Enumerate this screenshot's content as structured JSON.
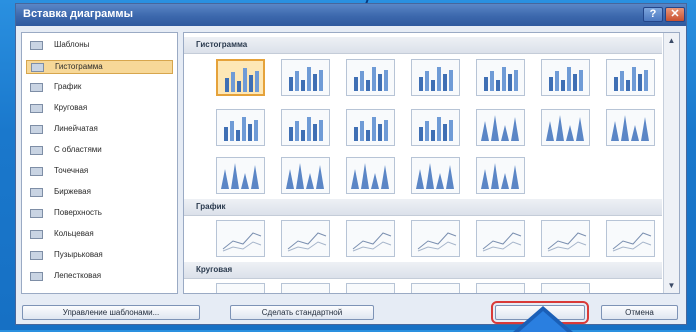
{
  "window": {
    "title": "Вставка диаграммы"
  },
  "titlebar_buttons": {
    "help": "?",
    "close": "✕"
  },
  "sidebar": {
    "items": [
      {
        "label": "Шаблоны",
        "icon": "folder-icon",
        "selected": false
      },
      {
        "label": "Гистограмма",
        "icon": "column-chart-icon",
        "selected": true
      },
      {
        "label": "График",
        "icon": "line-chart-icon",
        "selected": false
      },
      {
        "label": "Круговая",
        "icon": "pie-chart-icon",
        "selected": false
      },
      {
        "label": "Линейчатая",
        "icon": "bar-chart-icon",
        "selected": false
      },
      {
        "label": "С областями",
        "icon": "area-chart-icon",
        "selected": false
      },
      {
        "label": "Точечная",
        "icon": "scatter-chart-icon",
        "selected": false
      },
      {
        "label": "Биржевая",
        "icon": "stock-chart-icon",
        "selected": false
      },
      {
        "label": "Поверхность",
        "icon": "surface-chart-icon",
        "selected": false
      },
      {
        "label": "Кольцевая",
        "icon": "doughnut-chart-icon",
        "selected": false
      },
      {
        "label": "Пузырьковая",
        "icon": "bubble-chart-icon",
        "selected": false
      },
      {
        "label": "Лепестковая",
        "icon": "radar-chart-icon",
        "selected": false
      }
    ]
  },
  "gallery": {
    "sections": [
      {
        "title": "Гистограмма"
      },
      {
        "title": "График"
      },
      {
        "title": "Круговая"
      }
    ]
  },
  "buttons": {
    "manage_templates": "Управление шаблонами...",
    "set_default": "Сделать стандартной",
    "ok": "",
    "cancel": "Отмена"
  },
  "colors": {
    "background": "#1c7fd2",
    "titlebar": "#3c68ad",
    "selection": "#f7d898",
    "highlight": "#d93a38",
    "arrow": "#1a5fb7"
  }
}
